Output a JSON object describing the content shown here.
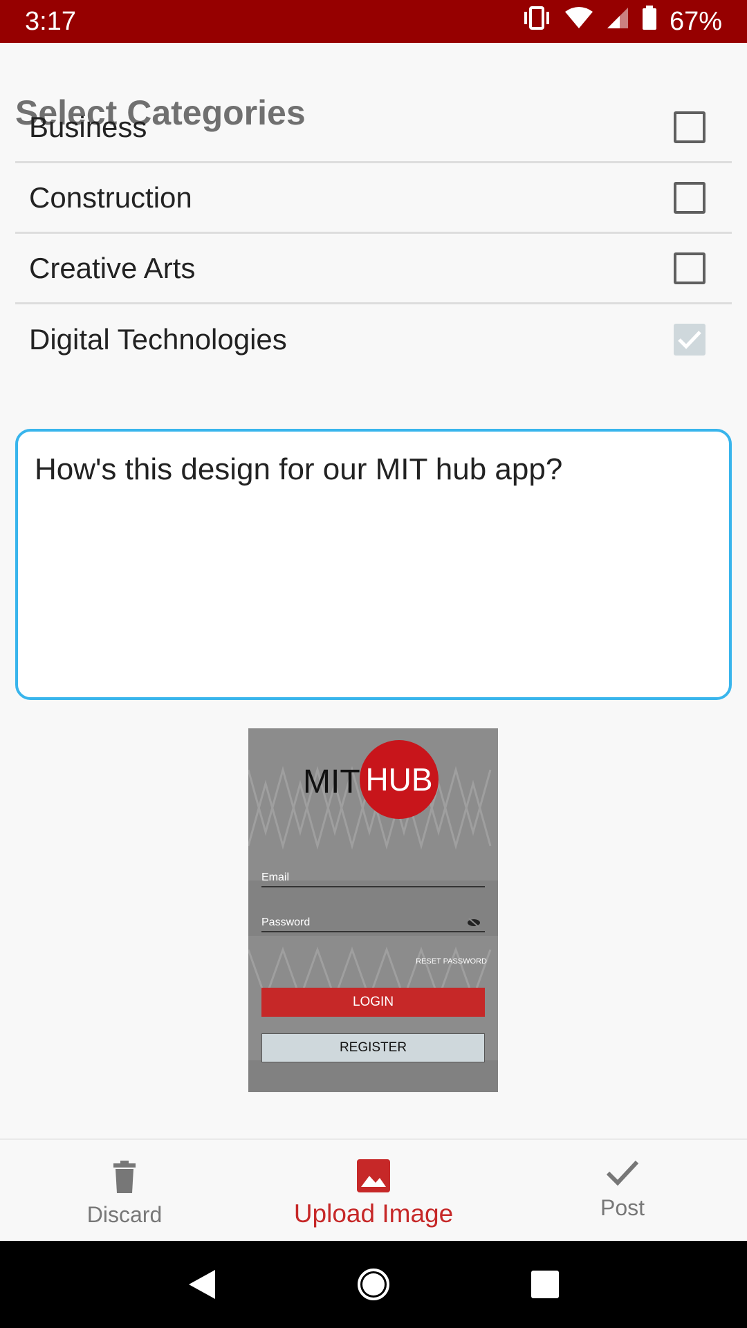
{
  "status_bar": {
    "time": "3:17",
    "battery": "67%"
  },
  "heading": "Select Categories",
  "categories": [
    {
      "label": "Business",
      "checked": false
    },
    {
      "label": "Construction",
      "checked": false
    },
    {
      "label": "Creative Arts",
      "checked": false
    },
    {
      "label": "Digital Technologies",
      "checked": true
    }
  ],
  "post_text": "How's this design for our MIT hub app?",
  "attached_image": {
    "logo_left": "MIT",
    "logo_right": "HUB",
    "email_label": "Email",
    "password_label": "Password",
    "reset_label": "RESET PASSWORD",
    "login_label": "LOGIN",
    "register_label": "REGISTER"
  },
  "bottom_nav": {
    "discard": "Discard",
    "upload": "Upload Image",
    "post": "Post"
  },
  "colors": {
    "status_bar": "#960000",
    "accent": "#c62828",
    "textarea_border": "#39b5ec"
  }
}
